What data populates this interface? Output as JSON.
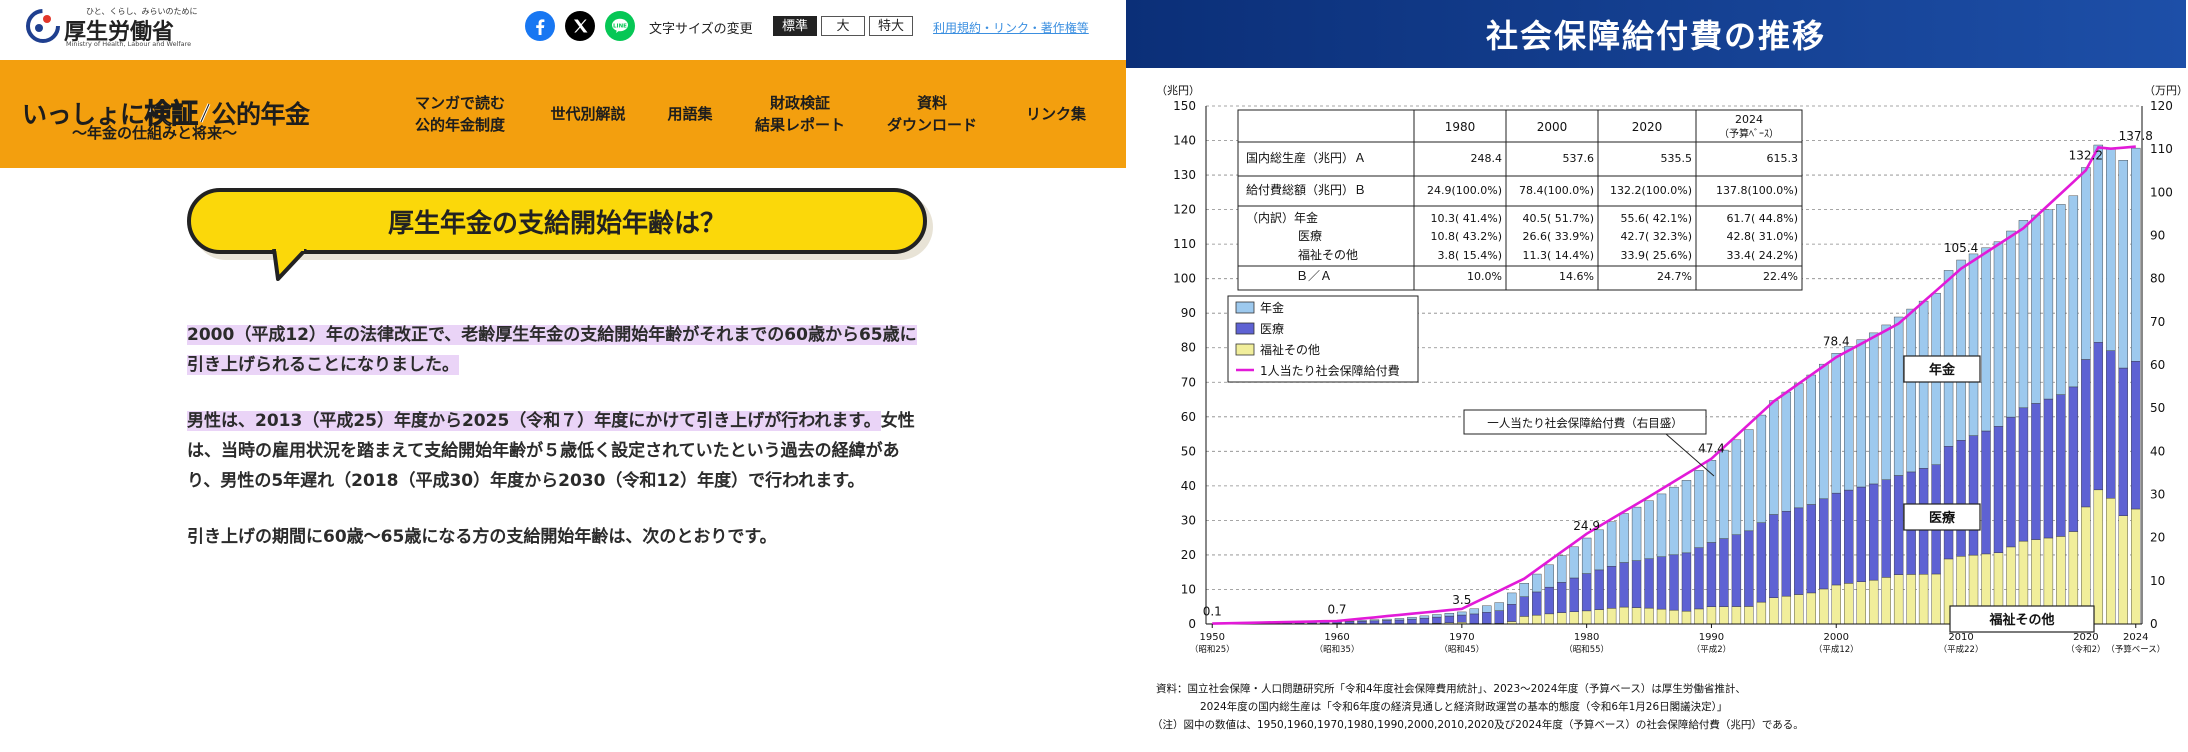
{
  "header": {
    "ministry_tagline": "ひと、くらし、みらいのために",
    "ministry_name": "厚生労働省",
    "ministry_en": "Ministry of Health, Labour and Welfare",
    "font_size_label": "文字サイズの変更",
    "font_sizes": [
      "標準",
      "大",
      "特大"
    ],
    "links_label": "利用規約・リンク・著作権等"
  },
  "nav": {
    "site_title_pre": "いっしょに",
    "site_title_em": "検証",
    "site_title_post": "公的年金",
    "site_subtitle": "〜年金の仕組みと将来〜",
    "items": [
      "マンガで読む\n公的年金制度",
      "世代別解説",
      "用語集",
      "財政検証\n結果レポート",
      "資料\nダウンロード",
      "リンク集"
    ]
  },
  "main": {
    "question": "厚生年金の支給開始年齢は？",
    "para1": "2000（平成12）年の法律改正で、老齢厚生年金の支給開始年齢がそれまでの60歳から65歳に引き上げられることになりました。",
    "para2_hl": "男性は、2013（平成25）年度から2025（令和７）年度にかけて引き上げが行われます。",
    "para2_rest": "女性は、当時の雇用状況を踏まえて支給開始年齢が５歳低く設定されていたという過去の経緯があり、男性の5年遅れ（2018（平成30）年度から2030（令和12）年度）で行われます。",
    "para3": "引き上げの期間に60歳〜65歳になる方の支給開始年齢は、次のとおりです。"
  },
  "chart_banner": "社会保障給付費の推移",
  "chart_data": {
    "type": "bar",
    "title": "社会保障給付費の推移",
    "ylabel_left": "（兆円）",
    "ylabel_right": "（万円）",
    "ylim_left": [
      0,
      150
    ],
    "ylim_right": [
      0,
      120
    ],
    "left_ticks": [
      0,
      10,
      20,
      30,
      40,
      50,
      60,
      70,
      80,
      90,
      100,
      110,
      120,
      130,
      140,
      150
    ],
    "right_ticks": [
      0,
      10,
      20,
      30,
      40,
      50,
      60,
      70,
      80,
      90,
      100,
      110,
      120
    ],
    "x_ticks": [
      {
        "year": 1950,
        "label": "1950",
        "sub": "（昭和25）"
      },
      {
        "year": 1960,
        "label": "1960",
        "sub": "（昭和35）"
      },
      {
        "year": 1970,
        "label": "1970",
        "sub": "（昭和45）"
      },
      {
        "year": 1980,
        "label": "1980",
        "sub": "（昭和55）"
      },
      {
        "year": 1990,
        "label": "1990",
        "sub": "（平成2）"
      },
      {
        "year": 2000,
        "label": "2000",
        "sub": "（平成12）"
      },
      {
        "year": 2010,
        "label": "2010",
        "sub": "（平成22）"
      },
      {
        "year": 2020,
        "label": "2020",
        "sub": "（令和2）"
      },
      {
        "year": 2024,
        "label": "2024",
        "sub": "（予算ベース）"
      }
    ],
    "stacked_series_names": [
      "年金",
      "医療",
      "福祉その他"
    ],
    "stacked_series_colors": [
      "#9dc9ee",
      "#5e62d3",
      "#f1ee9b"
    ],
    "line_series_name": "1人当たり社会保障給付費",
    "line_color": "#e21ad8",
    "legend_entries": [
      "年金",
      "医療",
      "福祉その他",
      "1人当たり社会保障給付費"
    ],
    "legend_position": "top-left",
    "grid": true,
    "total_points": [
      [
        1950,
        0.1
      ],
      [
        1955,
        0.4
      ],
      [
        1960,
        0.7
      ],
      [
        1965,
        1.6
      ],
      [
        1970,
        3.5
      ],
      [
        1973,
        6.2
      ],
      [
        1975,
        11.8
      ],
      [
        1978,
        19.8
      ],
      [
        1980,
        24.9
      ],
      [
        1983,
        32.0
      ],
      [
        1985,
        35.7
      ],
      [
        1988,
        41.6
      ],
      [
        1990,
        47.4
      ],
      [
        1993,
        56.3
      ],
      [
        1995,
        64.7
      ],
      [
        1998,
        72.1
      ],
      [
        2000,
        78.4
      ],
      [
        2003,
        84.3
      ],
      [
        2005,
        88.9
      ],
      [
        2008,
        95.8
      ],
      [
        2009,
        102.4
      ],
      [
        2010,
        105.4
      ],
      [
        2013,
        110.7
      ],
      [
        2015,
        116.9
      ],
      [
        2018,
        121.5
      ],
      [
        2019,
        124.0
      ],
      [
        2020,
        132.2
      ],
      [
        2021,
        138.7
      ],
      [
        2022,
        137.8
      ],
      [
        2023,
        134.3
      ],
      [
        2024,
        137.8
      ]
    ],
    "pension_points": [
      [
        1950,
        0.0
      ],
      [
        1960,
        0.1
      ],
      [
        1970,
        0.9
      ],
      [
        1975,
        3.9
      ],
      [
        1980,
        10.3
      ],
      [
        1985,
        16.8
      ],
      [
        1990,
        23.8
      ],
      [
        1995,
        33.0
      ],
      [
        2000,
        40.5
      ],
      [
        2005,
        45.9
      ],
      [
        2010,
        52.2
      ],
      [
        2015,
        54.3
      ],
      [
        2020,
        55.6
      ],
      [
        2024,
        61.7
      ]
    ],
    "medical_points": [
      [
        1950,
        0.1
      ],
      [
        1960,
        0.4
      ],
      [
        1970,
        2.1
      ],
      [
        1975,
        5.7
      ],
      [
        1980,
        10.8
      ],
      [
        1985,
        14.3
      ],
      [
        1990,
        18.6
      ],
      [
        1995,
        24.1
      ],
      [
        2000,
        26.6
      ],
      [
        2005,
        28.7
      ],
      [
        2010,
        33.6
      ],
      [
        2015,
        38.6
      ],
      [
        2020,
        42.7
      ],
      [
        2024,
        42.8
      ]
    ],
    "per_capita_points": [
      [
        1950,
        0.1
      ],
      [
        1960,
        0.7
      ],
      [
        1970,
        3.5
      ],
      [
        1975,
        10.5
      ],
      [
        1980,
        20.9
      ],
      [
        1985,
        29.5
      ],
      [
        1990,
        38.3
      ],
      [
        1995,
        51.6
      ],
      [
        2000,
        61.8
      ],
      [
        2005,
        69.6
      ],
      [
        2010,
        82.3
      ],
      [
        2015,
        91.7
      ],
      [
        2020,
        105.1
      ],
      [
        2021,
        110.4
      ],
      [
        2022,
        110.1
      ],
      [
        2024,
        110.6
      ]
    ],
    "value_labels": [
      {
        "x": 1950,
        "v": 0.1,
        "text": "0.1"
      },
      {
        "x": 1960,
        "v": 0.7,
        "text": "0.7"
      },
      {
        "x": 1970,
        "v": 3.5,
        "text": "3.5"
      },
      {
        "x": 1980,
        "v": 24.9,
        "text": "24.9"
      },
      {
        "x": 1990,
        "v": 47.4,
        "text": "47.4"
      },
      {
        "x": 2000,
        "v": 78.4,
        "text": "78.4"
      },
      {
        "x": 2010,
        "v": 105.4,
        "text": "105.4"
      },
      {
        "x": 2020,
        "v": 132.2,
        "text": "132.2"
      },
      {
        "x": 2024,
        "v": 137.8,
        "text": "137.8"
      }
    ],
    "table": {
      "headers": [
        "",
        "1980",
        "2000",
        "2020",
        "2024\n（予算ﾍﾞｰｽ）"
      ],
      "rows": [
        [
          "国内総生産（兆円）Ａ",
          "248.4",
          "537.6",
          "535.5",
          "615.3"
        ],
        [
          "給付費総額（兆円）Ｂ",
          "24.9(100.0%)",
          "78.4(100.0%)",
          "132.2(100.0%)",
          "137.8(100.0%)"
        ],
        [
          "（内訳）年金",
          "10.3( 41.4%)",
          "40.5( 51.7%)",
          "55.6( 42.1%)",
          "61.7( 44.8%)"
        ],
        [
          "医療",
          "10.8( 43.2%)",
          "26.6( 33.9%)",
          "42.7( 32.3%)",
          "42.8( 31.0%)"
        ],
        [
          "福祉その他",
          "3.8( 15.4%)",
          "11.3( 14.4%)",
          "33.9( 25.6%)",
          "33.4( 24.2%)"
        ],
        [
          "Ｂ／Ａ",
          "10.0%",
          "14.6%",
          "24.7%",
          "22.4%"
        ]
      ]
    },
    "annotations": [
      "一人当たり社会保障給付費（右目盛）",
      "年金",
      "医療",
      "福祉その他"
    ],
    "notes": [
      "資料：国立社会保障・人口問題研究所「令和4年度社会保障費用統計」、2023〜2024年度（予算ベース）は厚生労働省推計、",
      "2024年度の国内総生産は「令和6年度の経済見通しと経済財政運営の基本的態度（令和6年1月26日閣議決定）」",
      "（注）図中の数値は、1950,1960,1970,1980,1990,2000,2010,2020及び2024年度（予算ベース）の社会保障給付費（兆円）である。"
    ]
  }
}
